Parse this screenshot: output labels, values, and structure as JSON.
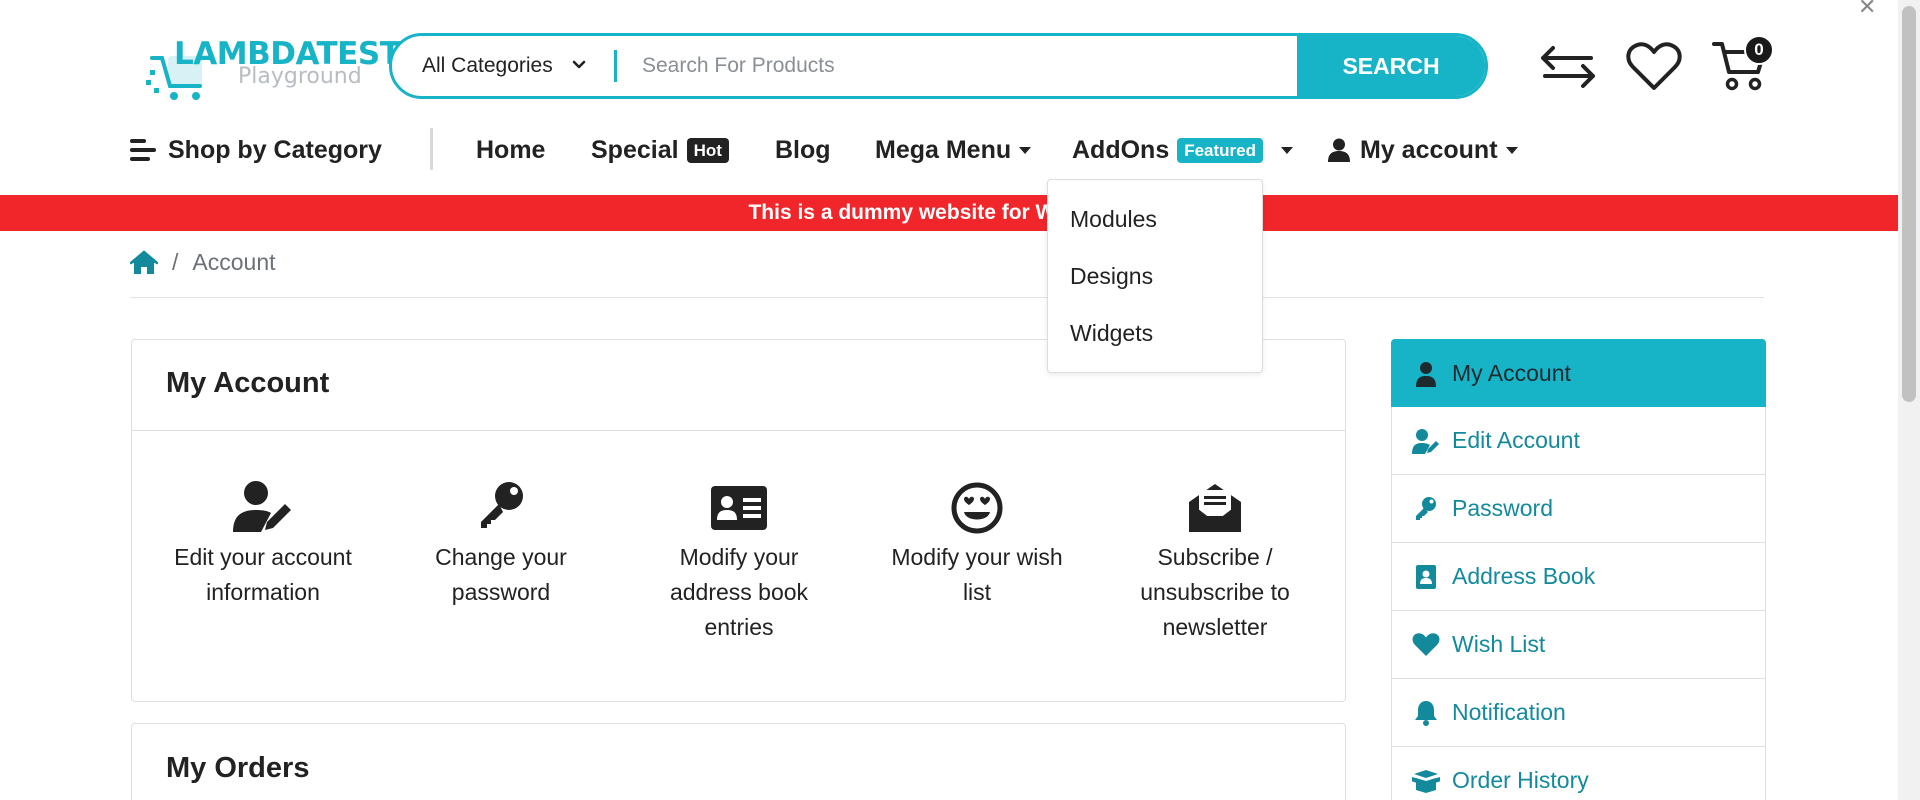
{
  "logo": {
    "title": "LAMBDATEST",
    "subtitle": "Playground"
  },
  "search": {
    "category": "All Categories",
    "placeholder": "Search For Products",
    "value": "",
    "button_label": "SEARCH"
  },
  "header": {
    "cart_count": "0"
  },
  "nav": {
    "shop_by_category": "Shop by Category",
    "home": "Home",
    "special": "Special",
    "special_badge": "Hot",
    "blog": "Blog",
    "mega_menu": "Mega Menu",
    "addons": "AddOns",
    "addons_badge": "Featured",
    "my_account": "My account"
  },
  "banner": {
    "text": "This is a dummy website for Web Aut"
  },
  "addons_dropdown": {
    "items": [
      "Modules",
      "Designs",
      "Widgets"
    ]
  },
  "breadcrumb": {
    "current": "Account",
    "separator": "/"
  },
  "my_account_card": {
    "title": "My Account",
    "tiles": [
      {
        "icon": "user-edit-icon",
        "line1": "Edit your account",
        "line2": "information",
        "line3": ""
      },
      {
        "icon": "key-icon",
        "line1": "Change your",
        "line2": "password",
        "line3": ""
      },
      {
        "icon": "address-card-icon",
        "line1": "Modify your",
        "line2": "address book",
        "line3": "entries"
      },
      {
        "icon": "smile-heart-eyes-icon",
        "line1": "Modify your wish",
        "line2": "list",
        "line3": ""
      },
      {
        "icon": "envelope-open-icon",
        "line1": "Subscribe /",
        "line2": "unsubscribe to",
        "line3": "newsletter"
      }
    ]
  },
  "my_orders_card": {
    "title": "My Orders"
  },
  "sidebar": {
    "items": [
      {
        "label": "My Account",
        "icon": "user-icon",
        "active": true
      },
      {
        "label": "Edit Account",
        "icon": "user-edit-icon",
        "active": false
      },
      {
        "label": "Password",
        "icon": "key-icon",
        "active": false
      },
      {
        "label": "Address Book",
        "icon": "address-book-icon",
        "active": false
      },
      {
        "label": "Wish List",
        "icon": "heart-icon",
        "active": false
      },
      {
        "label": "Notification",
        "icon": "bell-icon",
        "active": false
      },
      {
        "label": "Order History",
        "icon": "box-open-icon",
        "active": false
      }
    ]
  },
  "colors": {
    "accent": "#17b3c6",
    "link": "#128a9c",
    "banner": "#f1262a",
    "text": "#222222"
  }
}
